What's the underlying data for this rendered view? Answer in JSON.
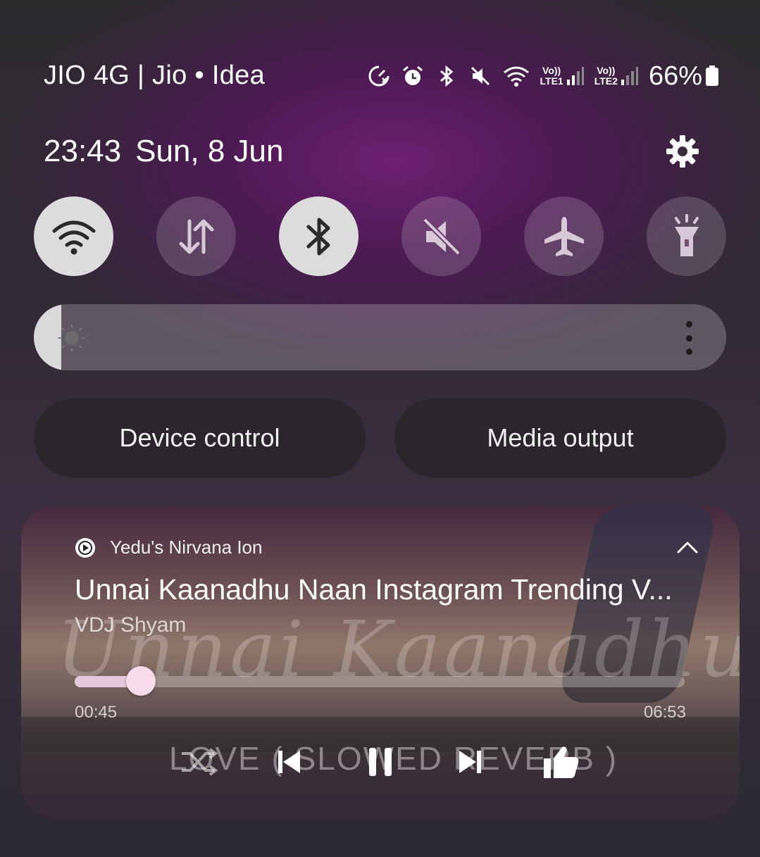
{
  "status_bar": {
    "carrier": "JIO 4G | Jio • Idea",
    "icons": [
      "data-saver-icon",
      "alarm-icon",
      "bluetooth-icon",
      "mute-icon",
      "wifi-icon",
      "signal-sim1-icon",
      "signal-sim2-icon",
      "battery-icon"
    ],
    "sim1_label": "Vo))\nLTE1",
    "sim2_label": "Vo))\nLTE2",
    "battery": "66%"
  },
  "header": {
    "time": "23:43",
    "date": "Sun, 8 Jun"
  },
  "quick_toggles": [
    {
      "name": "wifi",
      "icon": "wifi-icon",
      "active": true
    },
    {
      "name": "mobile-data",
      "icon": "data-arrows-icon",
      "active": false
    },
    {
      "name": "bluetooth",
      "icon": "bluetooth-icon",
      "active": true
    },
    {
      "name": "sound",
      "icon": "mute-icon",
      "active": false
    },
    {
      "name": "airplane-mode",
      "icon": "airplane-icon",
      "active": false
    },
    {
      "name": "flashlight",
      "icon": "flashlight-icon",
      "active": false
    }
  ],
  "brightness": {
    "level": 0.04
  },
  "buttons": {
    "device_control": "Device control",
    "media_output": "Media output"
  },
  "media": {
    "app_name": "Yedu's Nirvana Ion",
    "title": "Unnai Kaanadhu Naan Instagram Trending V...",
    "artist": "VDJ Shyam",
    "elapsed": "00:45",
    "total": "06:53",
    "progress": 0.109,
    "artwork_script_text": "Unnai Kaanadhu Naa",
    "artwork_caption": "LOVE ( SLOWED REVERB )",
    "colors": {
      "accent": "#f7dbea"
    }
  }
}
